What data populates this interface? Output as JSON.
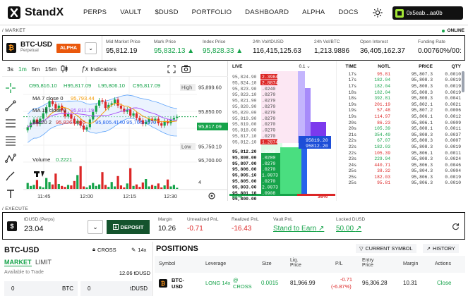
{
  "header": {
    "brand": "StandX",
    "nav": [
      "PERPS",
      "VAULT",
      "$DUSD",
      "PORTFOLIO",
      "DASHBOARD",
      "ALPHA",
      "DOCS"
    ],
    "wallet": "0x5eab...aa0b"
  },
  "sections": {
    "market": "/ MARKET",
    "execute": "/ EXECUTE",
    "status": "ONLINE"
  },
  "market": {
    "pair": "BTC-USD",
    "type": "Perpetual",
    "badge": "ALPHA",
    "stats": [
      {
        "label": "Mid Market Price",
        "value": "95,812.19",
        "tone": "neutral"
      },
      {
        "label": "Mark Price",
        "value": "95,832.13",
        "arrow": "▲",
        "tone": "green"
      },
      {
        "label": "Index Price",
        "value": "95,828.33",
        "arrow": "▲",
        "tone": "green"
      },
      {
        "label": "24h Vol/tDUSD",
        "value": "116,415,125.63",
        "tone": "neutral"
      },
      {
        "label": "24h Vol/BTC",
        "value": "1,213.9886",
        "tone": "neutral"
      },
      {
        "label": "Open Interest",
        "value": "36,405,162.37",
        "tone": "neutral"
      },
      {
        "label": "Funding Rate",
        "value": "0.00760%/00:",
        "tone": "neutral"
      }
    ]
  },
  "chart": {
    "intervals": [
      "3s",
      "1m",
      "5m",
      "15m"
    ],
    "active_interval": "1m",
    "indicators_label": "Indicators",
    "ohlc": {
      "o": "O95,816.10",
      "h": "H95,817.09",
      "l": "L95,806.10",
      "c": "C95,817.09"
    },
    "ma7_label": "MA 7 close 0",
    "ma7_value": "95,793.44",
    "ma15_label": "MA 15 close 0",
    "ma15_value": "95,811.19",
    "bb_label": "BB 20 2",
    "bb_values": [
      "95,826.1055",
      "95,805.4140",
      "95,766.7970"
    ],
    "volume_label": "Volume",
    "volume_value": "0.2221",
    "price_ticks": [
      "95,899.60",
      "95,850.00",
      "95,750.10",
      "95,700.00"
    ],
    "high_label": "High",
    "low_label": "Low",
    "last_price": "95,817.09",
    "vol_tick": "4",
    "time_ticks": [
      "11:45",
      "12:00",
      "12:15",
      "12:30"
    ]
  },
  "chart_data": {
    "type": "candlestick",
    "x": [
      "11:42",
      "11:43",
      "11:44",
      "11:45",
      "11:46",
      "11:47",
      "11:48",
      "11:49",
      "11:50",
      "11:51",
      "11:52",
      "11:53",
      "11:54",
      "11:55",
      "11:56",
      "11:57",
      "11:58",
      "11:59",
      "12:00",
      "12:01",
      "12:02",
      "12:03",
      "12:04",
      "12:05",
      "12:06",
      "12:07",
      "12:08",
      "12:09",
      "12:10",
      "12:11",
      "12:12",
      "12:13",
      "12:14",
      "12:15",
      "12:16",
      "12:17",
      "12:18",
      "12:19",
      "12:20",
      "12:21",
      "12:22",
      "12:23",
      "12:24",
      "12:25",
      "12:26",
      "12:27",
      "12:28",
      "12:29",
      "12:30"
    ],
    "close": [
      95790,
      95802,
      95810,
      95798,
      95812,
      95826,
      95842,
      95858,
      95850,
      95838,
      95846,
      95834,
      95818,
      95824,
      95812,
      95800,
      95806,
      95794,
      95784,
      95790,
      95810,
      95830,
      95846,
      95860,
      95856,
      95840,
      95848,
      95852,
      95862,
      95846,
      95838,
      95830,
      95836,
      95820,
      95826,
      95814,
      95808,
      95798,
      95804,
      95812,
      95806,
      95812,
      95800,
      95794,
      95806,
      95800,
      95810,
      95814,
      95817
    ],
    "volume": [
      1.2,
      0.6,
      0.8,
      1.8,
      0.5,
      0.3,
      2.2,
      1.4,
      0.9,
      3.1,
      1.0,
      0.6,
      0.4,
      0.8,
      0.7,
      1.6,
      2.8,
      4.6,
      0.5,
      0.3,
      0.7,
      1.2,
      0.6,
      0.9,
      3.4,
      0.8,
      0.4,
      1.4,
      0.5,
      2.6,
      0.7,
      0.3,
      1.1,
      4.2,
      0.6,
      0.9,
      0.4,
      1.3,
      2.0,
      0.5,
      0.8,
      0.6,
      1.1,
      0.3,
      0.7,
      1.9,
      0.5,
      0.8,
      0.22
    ],
    "ylim": [
      95690,
      95910
    ]
  },
  "orderbook": {
    "header_live": "LIVE",
    "header_step": "0.1",
    "asks": [
      {
        "price": "95,824.90",
        "size": "2.3984"
      },
      {
        "price": "95,824.10",
        "size": "2.8874"
      },
      {
        "price": "95,823.90",
        "size": ".0240"
      },
      {
        "price": "95,823.10",
        "size": ".0270"
      },
      {
        "price": "95,821.90",
        "size": ".0270"
      },
      {
        "price": "95,820.90",
        "size": ".0270"
      },
      {
        "price": "95,820.00",
        "size": ".0270"
      },
      {
        "price": "95,819.90",
        "size": ".0270"
      },
      {
        "price": "95,819.00",
        "size": ".0270"
      },
      {
        "price": "95,818.00",
        "size": ".0270"
      },
      {
        "price": "95,817.10",
        "size": ".0270"
      },
      {
        "price": "95,812.10",
        "size": "1.2874"
      }
    ],
    "bids": [
      {
        "price": "95,812.20",
        "size": ".0060"
      },
      {
        "price": "95,808.00",
        "size": ".0280"
      },
      {
        "price": "95,807.00",
        "size": ".0270"
      },
      {
        "price": "95,806.00",
        "size": ".0270"
      },
      {
        "price": "95,805.10",
        "size": "1.0873"
      },
      {
        "price": "95,805.00",
        "size": ".0270"
      },
      {
        "price": "95,803.00",
        "size": "2.0873"
      },
      {
        "price": "95,801.10",
        "size": ".0908"
      },
      {
        "price": "95,800.00",
        "size": ".0873"
      },
      {
        "price": "95,799.10",
        "size": "1.3865"
      }
    ],
    "mid_labels": [
      "95819.20",
      "95812.20"
    ],
    "bid_pct": "64%",
    "ask_pct": "36%"
  },
  "trades": {
    "headers": [
      "TIME",
      "NOTL",
      "PRICE",
      "QTY"
    ],
    "rows": [
      {
        "t": "17s",
        "n": "95.81",
        "p": "95,807.3",
        "q": "0.0010",
        "side": "sell"
      },
      {
        "t": "17s",
        "n": "182.04",
        "p": "95,808.3",
        "q": "0.0019",
        "side": "buy"
      },
      {
        "t": "17s",
        "n": "182.04",
        "p": "95,808.3",
        "q": "0.0019",
        "side": "buy"
      },
      {
        "t": "18s",
        "n": "182.04",
        "p": "95,808.3",
        "q": "0.0019",
        "side": "buy"
      },
      {
        "t": "18s",
        "n": "392.81",
        "p": "95,808.3",
        "q": "0.0041",
        "side": "buy"
      },
      {
        "t": "19s",
        "n": "201.19",
        "p": "95,802.1",
        "q": "0.0021",
        "side": "sell"
      },
      {
        "t": "19s",
        "n": "57.48",
        "p": "95,807.2",
        "q": "0.0006",
        "side": "sell"
      },
      {
        "t": "19s",
        "n": "114.97",
        "p": "95,806.1",
        "q": "0.0012",
        "side": "sell"
      },
      {
        "t": "20s",
        "n": "86.23",
        "p": "95,806.1",
        "q": "0.0009",
        "side": "sell"
      },
      {
        "t": "20s",
        "n": "105.39",
        "p": "95,808.1",
        "q": "0.0011",
        "side": "buy"
      },
      {
        "t": "21s",
        "n": "354.49",
        "p": "95,808.3",
        "q": "0.0037",
        "side": "buy"
      },
      {
        "t": "22s",
        "n": "67.07",
        "p": "95,808.3",
        "q": "0.0007",
        "side": "buy"
      },
      {
        "t": "22s",
        "n": "182.03",
        "p": "95,808.3",
        "q": "0.0019",
        "side": "buy"
      },
      {
        "t": "22s",
        "n": "105.39",
        "p": "95,806.1",
        "q": "0.0011",
        "side": "sell"
      },
      {
        "t": "23s",
        "n": "229.94",
        "p": "95,808.3",
        "q": "0.0024",
        "side": "buy"
      },
      {
        "t": "24s",
        "n": "440.71",
        "p": "95,806.3",
        "q": "0.0046",
        "side": "sell"
      },
      {
        "t": "25s",
        "n": "38.32",
        "p": "95,804.3",
        "q": "0.0004",
        "side": "sell"
      },
      {
        "t": "25s",
        "n": "182.03",
        "p": "95,806.3",
        "q": "0.0019",
        "side": "sell"
      },
      {
        "t": "25s",
        "n": "95.81",
        "p": "95,806.3",
        "q": "0.0010",
        "side": "sell"
      }
    ]
  },
  "execute": {
    "asset_label": "tDUSD (Perps)",
    "asset_value": "23.04",
    "deposit": "DEPOSIT",
    "margin_label": "Margin",
    "margin_value": "10.26",
    "upnl_label": "Unrealized PnL",
    "upnl_value": "-0.71",
    "rpnl_label": "Realized PnL",
    "rpnl_value": "-16.43",
    "vault_label": "Vault PnL",
    "vault_value": "Stand to Earn",
    "locked_label": "Locked DUSD",
    "locked_value": "50.00"
  },
  "order": {
    "pair": "BTC-USD",
    "cross": "CROSS",
    "leverage": "14x",
    "tabs": [
      "MARKET",
      "LIMIT"
    ],
    "avail_label": "Available to Trade",
    "avail_value": "12.06 tDUSD",
    "qty_btc": "0",
    "btc_unit": "BTC",
    "qty_usd": "0",
    "usd_unit": "tDUSD"
  },
  "positions": {
    "title": "POSITIONS",
    "btn_current": "CURRENT SYMBOL",
    "btn_history": "HISTORY",
    "headers": [
      "Symbol",
      "Leverage",
      "Size",
      "Liq. Price",
      "P/L",
      "Entry Price",
      "Margin",
      "Actions"
    ],
    "row": {
      "symbol": "BTC-USD",
      "leverage": "LONG 14x",
      "mode": "@ CROSS",
      "size": "0.0015",
      "liq": "81,966.99",
      "pl": "-0.71",
      "pl_pct": "(-6.87%)",
      "entry": "96,306.28",
      "margin": "10.31",
      "action": "Close"
    }
  },
  "colors": {
    "green": "#16a34a",
    "red": "#dc2626",
    "orange": "#ea580c",
    "dark": "#111111"
  }
}
